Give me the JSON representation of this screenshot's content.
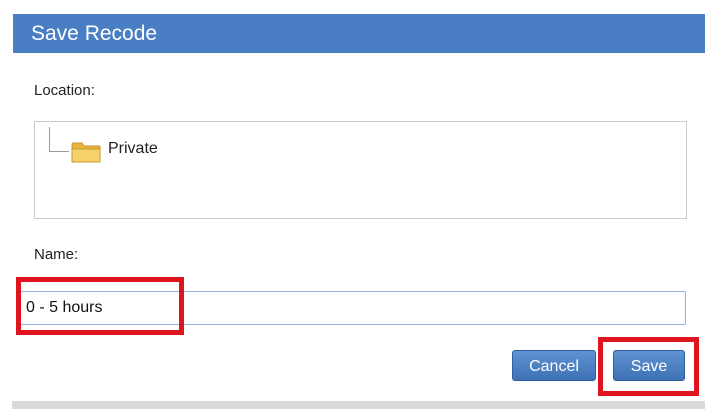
{
  "dialog": {
    "title": "Save Recode",
    "location_label": "Location:",
    "tree": {
      "items": [
        {
          "label": "Private",
          "icon": "folder-icon"
        }
      ]
    },
    "name_label": "Name:",
    "name_value": "0 - 5 hours",
    "buttons": {
      "cancel": "Cancel",
      "save": "Save"
    }
  },
  "colors": {
    "titlebar": "#4a7ec4",
    "button": "#4a7ec4",
    "highlight": "#e0141e",
    "folder": "#f2c14e"
  }
}
